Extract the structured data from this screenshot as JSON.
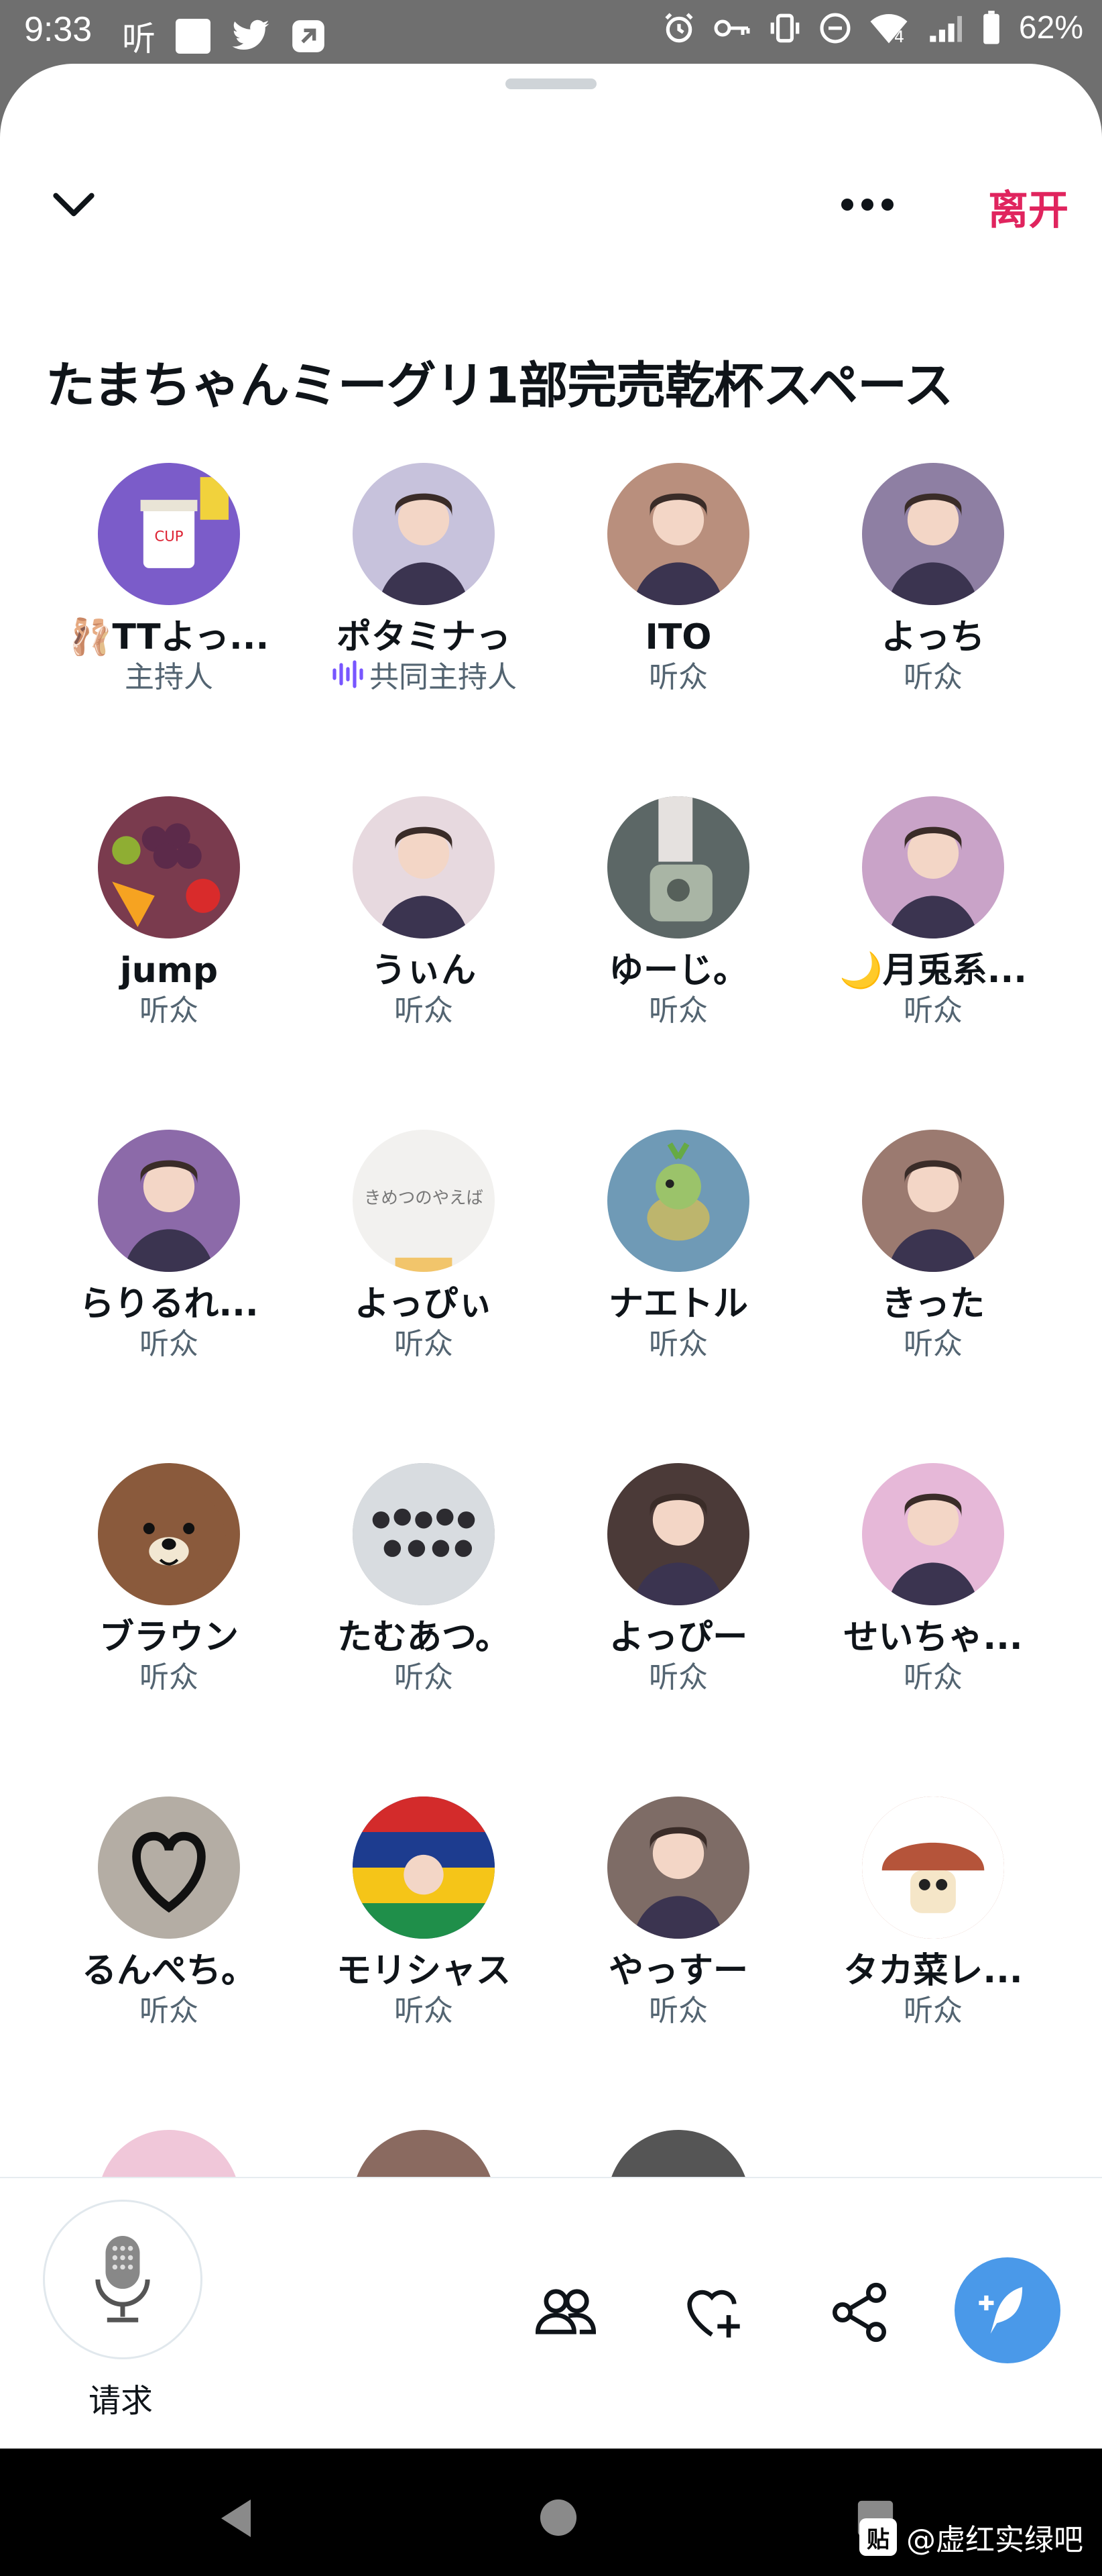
{
  "status_bar": {
    "time": "9:33",
    "left_icon_text": "听",
    "battery_text": "62%",
    "network": "4"
  },
  "header": {
    "leave_label": "离开"
  },
  "space": {
    "title": "たまちゃんミーグリ1部完売乾杯スペース"
  },
  "participants": [
    {
      "name": "TTよっ...",
      "role": "主持人",
      "avatar_color": "#7b5cc9",
      "avatar_icon": "cup-noodle-avatar",
      "name_prefix": "🩰"
    },
    {
      "name": "ポタミナっ",
      "role": "共同主持人",
      "avatar_color": "#c7c2dc",
      "avatar_icon": "person-photo-avatar",
      "speaking": true
    },
    {
      "name": "ITO",
      "role": "听众",
      "avatar_color": "#b98f7d",
      "avatar_icon": "person-photo-avatar"
    },
    {
      "name": "よっち",
      "role": "听众",
      "avatar_color": "#8e7fa3",
      "avatar_icon": "person-photo-avatar"
    },
    {
      "name": "jump",
      "role": "听众",
      "avatar_color": "#7a3b4e",
      "avatar_icon": "fruit-avatar"
    },
    {
      "name": "うぃん",
      "role": "听众",
      "avatar_color": "#e7d9df",
      "avatar_icon": "person-photo-avatar"
    },
    {
      "name": "ゆーじ。",
      "role": "听众",
      "avatar_color": "#5c6766",
      "avatar_icon": "object-photo-avatar"
    },
    {
      "name": "月兎系...",
      "role": "听众",
      "avatar_color": "#c9a3c8",
      "avatar_icon": "person-photo-avatar",
      "name_prefix": "🌙"
    },
    {
      "name": "らりるれ...",
      "role": "听众",
      "avatar_color": "#8c6aa9",
      "avatar_icon": "person-photo-avatar"
    },
    {
      "name": "よっぴぃ",
      "role": "听众",
      "avatar_color": "#f2f1ef",
      "avatar_icon": "handwriting-avatar"
    },
    {
      "name": "ナエトル",
      "role": "听众",
      "avatar_color": "#6f9ab6",
      "avatar_icon": "turtle-avatar"
    },
    {
      "name": "きった",
      "role": "听众",
      "avatar_color": "#9b7a70",
      "avatar_icon": "person-photo-avatar"
    },
    {
      "name": "ブラウン",
      "role": "听众",
      "avatar_color": "#8a5a3c",
      "avatar_icon": "bear-avatar"
    },
    {
      "name": "たむあつ。",
      "role": "听众",
      "avatar_color": "#9fa3a8",
      "avatar_icon": "group-photo-avatar"
    },
    {
      "name": "よっぴー",
      "role": "听众",
      "avatar_color": "#4b3a38",
      "avatar_icon": "person-photo-avatar"
    },
    {
      "name": "せいちゃ...",
      "role": "听众",
      "avatar_color": "#e6b8d8",
      "avatar_icon": "person-photo-avatar"
    },
    {
      "name": "るんぺち。",
      "role": "听众",
      "avatar_color": "#b4ada4",
      "avatar_icon": "heart-drawing-avatar"
    },
    {
      "name": "モリシャス",
      "role": "听众",
      "avatar_color": "#2a4d8f",
      "avatar_icon": "flag-avatar"
    },
    {
      "name": "やっすー",
      "role": "听众",
      "avatar_color": "#7e6c66",
      "avatar_icon": "person-photo-avatar"
    },
    {
      "name": "タカ菜レ...",
      "role": "听众",
      "avatar_color": "#b5543a",
      "avatar_icon": "mushroom-avatar"
    },
    {
      "name": "",
      "role": "",
      "avatar_color": "#f0c7d9",
      "avatar_icon": "partial-avatar"
    },
    {
      "name": "",
      "role": "",
      "avatar_color": "#8a6a60",
      "avatar_icon": "partial-avatar"
    },
    {
      "name": "",
      "role": "",
      "avatar_color": "#555555",
      "avatar_icon": "partial-avatar"
    }
  ],
  "bottom_bar": {
    "mic_label": "请求",
    "icons": [
      "people-icon",
      "heart-plus-icon",
      "share-icon",
      "compose-icon"
    ]
  },
  "watermark": {
    "logo_text": "贴",
    "text": "@虚红实绿吧"
  },
  "colors": {
    "accent_leave": "#e0245e",
    "compose_button": "#4a99e9",
    "secondary_text": "#536471",
    "speaking_wave": "#7856ff"
  }
}
